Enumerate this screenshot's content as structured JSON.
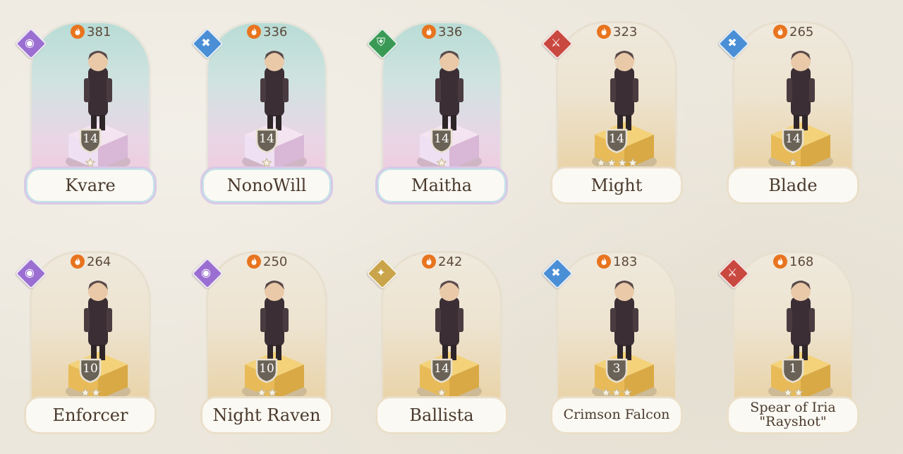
{
  "colors": {
    "class_arcane": "#9b6fd1",
    "class_striker": "#4a8fd6",
    "class_defender": "#3a9a55",
    "class_warrior": "#c9483f",
    "class_support": "#c9a44a"
  },
  "heroes": [
    {
      "name": "Kvare",
      "power": "381",
      "level": "14",
      "stars": 1,
      "rarity": "rainbow",
      "class_icon": "arcane-class-icon",
      "class_color": "#9b6fd1"
    },
    {
      "name": "NonoWill",
      "power": "336",
      "level": "14",
      "stars": 1,
      "rarity": "rainbow",
      "class_icon": "striker-class-icon",
      "class_color": "#4a8fd6"
    },
    {
      "name": "Maitha",
      "power": "336",
      "level": "14",
      "stars": 1,
      "rarity": "rainbow",
      "class_icon": "defender-class-icon",
      "class_color": "#3a9a55"
    },
    {
      "name": "Might",
      "power": "323",
      "level": "14",
      "stars": 4,
      "rarity": "gold",
      "class_icon": "warrior-class-icon",
      "class_color": "#c9483f"
    },
    {
      "name": "Blade",
      "power": "265",
      "level": "14",
      "stars": 1,
      "rarity": "gold",
      "class_icon": "striker-class-icon",
      "class_color": "#4a8fd6"
    },
    {
      "name": "Enforcer",
      "power": "264",
      "level": "10",
      "stars": 2,
      "rarity": "gold",
      "class_icon": "arcane-class-icon",
      "class_color": "#9b6fd1"
    },
    {
      "name": "Night Raven",
      "power": "250",
      "level": "10",
      "stars": 2,
      "rarity": "gold",
      "class_icon": "arcane-class-icon",
      "class_color": "#9b6fd1"
    },
    {
      "name": "Ballista",
      "power": "242",
      "level": "14",
      "stars": 1,
      "rarity": "gold",
      "class_icon": "support-class-icon",
      "class_color": "#c9a44a"
    },
    {
      "name": "Crimson Falcon",
      "power": "183",
      "level": "3",
      "stars": 3,
      "rarity": "gold",
      "class_icon": "striker-class-icon",
      "class_color": "#4a8fd6"
    },
    {
      "name": "Spear of Iria\n\"Rayshot\"",
      "power": "168",
      "level": "1",
      "stars": 2,
      "rarity": "gold",
      "class_icon": "warrior-class-icon",
      "class_color": "#c9483f"
    }
  ]
}
